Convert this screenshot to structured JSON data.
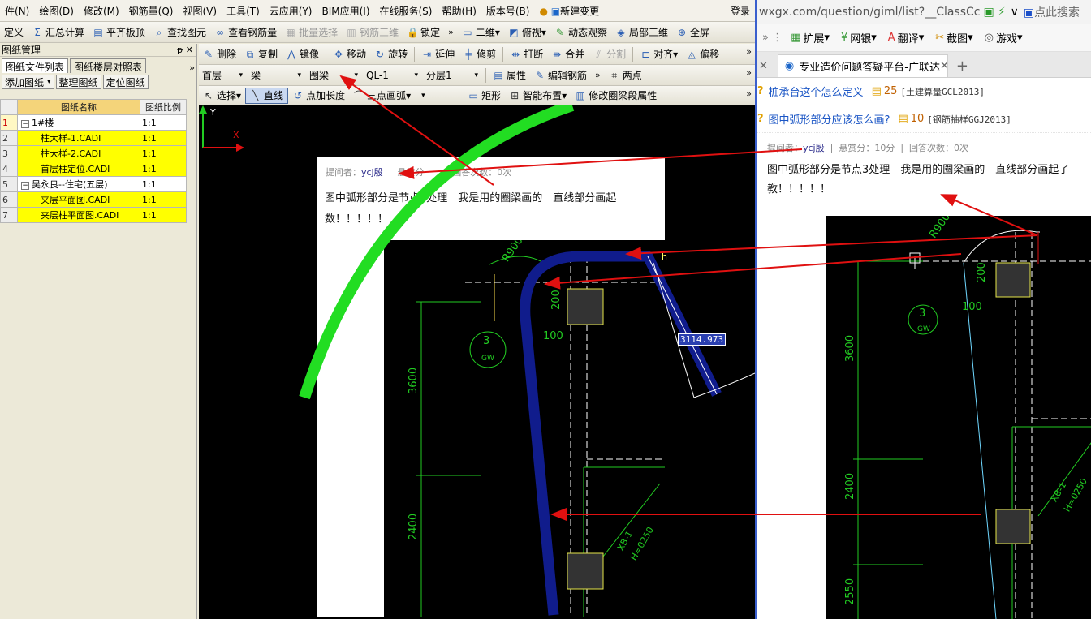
{
  "menu": {
    "items": [
      "件(N)",
      "绘图(D)",
      "修改(M)",
      "钢筋量(Q)",
      "视图(V)",
      "工具(T)",
      "云应用(Y)",
      "BIM应用(I)",
      "在线服务(S)",
      "帮助(H)",
      "版本号(B)"
    ],
    "new_change": "新建变更",
    "login": "登录"
  },
  "toolbar1": {
    "items": [
      "定义",
      "汇总计算",
      "平齐板顶",
      "查找图元",
      "查看钢筋量",
      "批量选择",
      "钢筋三维",
      "锁定"
    ],
    "view2d": "二维",
    "view_top": "俯视",
    "dynamic": "动态观察",
    "local3d": "局部三维",
    "fullscreen": "全屏"
  },
  "toolbar2": {
    "items": [
      "删除",
      "复制",
      "镜像",
      "移动",
      "旋转",
      "延伸",
      "修剪",
      "打断",
      "合并",
      "分割",
      "对齐",
      "偏移"
    ]
  },
  "toolbar3": {
    "floor": "首层",
    "category": "梁",
    "type": "圈梁",
    "element": "QL-1",
    "layer": "分层1",
    "props": "属性",
    "edit_rebar": "编辑钢筋",
    "two_points": "两点"
  },
  "toolbar4": {
    "select": "选择",
    "line": "直线",
    "point_length": "点加长度",
    "arc3": "三点画弧",
    "rect": "矩形",
    "smart": "智能布置",
    "modify_ql": "修改圈梁段属性"
  },
  "panel": {
    "title": "图纸管理",
    "tab_files": "图纸文件列表",
    "tab_floors": "图纸楼层对照表",
    "btn_add": "添加图纸",
    "btn_organize": "整理图纸",
    "btn_locate": "定位图纸",
    "col_name": "图纸名称",
    "col_scale": "图纸比例",
    "rows": [
      {
        "n": "1",
        "name": "1#楼",
        "scale": "1:1",
        "tree": "−",
        "level": 0,
        "yellow": false
      },
      {
        "n": "2",
        "name": "柱大样-1.CADI",
        "scale": "1:1",
        "tree": "",
        "level": 1,
        "yellow": true
      },
      {
        "n": "3",
        "name": "柱大样-2.CADI",
        "scale": "1:1",
        "tree": "",
        "level": 1,
        "yellow": true
      },
      {
        "n": "4",
        "name": "首层柱定位.CADI",
        "scale": "1:1",
        "tree": "",
        "level": 1,
        "yellow": true
      },
      {
        "n": "5",
        "name": "吴永良--住宅(五层)",
        "scale": "1:1",
        "tree": "−",
        "level": 0,
        "yellow": false
      },
      {
        "n": "6",
        "name": "夹层平面图.CADI",
        "scale": "1:1",
        "tree": "",
        "level": 1,
        "yellow": true
      },
      {
        "n": "7",
        "name": "夹层柱平面图.CADI",
        "scale": "1:1",
        "tree": "",
        "level": 1,
        "yellow": true
      }
    ]
  },
  "canvas": {
    "asker_label": "提问者：",
    "asker": "ycj殷",
    "reward_partial": "悬赏分",
    "answers_partial": "回答次数：0次",
    "question_line1": "图中弧形部分是节点3处理　我是用的圈梁画的　直线部分画起",
    "question_line2": "数！！！！！",
    "measure": "3114.973",
    "dim_r900": "R900",
    "dim_200": "200",
    "dim_100": "100",
    "dim_3600": "3600",
    "dim_2400": "2400",
    "label_3": "3",
    "label_gw": "GW",
    "label_xb": "XB-1",
    "label_h": "H=0250",
    "axis_y": "Y",
    "axis_x": "X"
  },
  "browser": {
    "url": "wxgx.com/question/giml/list?__ClassCc",
    "search": "点此搜索",
    "bookmarks": [
      "扩展",
      "网银",
      "翻译",
      "截图",
      "游戏"
    ],
    "tab_title": "专业造价问题答疑平台-广联达",
    "q1_link": "桩承台这个怎么定义",
    "q1_pts": "25",
    "q1_tag": "[土建算量GCL2013]",
    "q2_link": "图中弧形部分应该怎么画?",
    "q2_pts": "10",
    "q2_tag": "[钢筋抽样GGJ2013]",
    "meta_asker_label": "提问者：",
    "meta_asker": "ycj殷",
    "meta_reward": "悬赏分：10分",
    "meta_answers": "回答次数：0次",
    "body_line1": "图中弧形部分是节点3处理　我是用的圈梁画的　直线部分画起了",
    "body_line2": "教！！！！！",
    "dim_3600": "3600",
    "dim_2400": "2400",
    "dim_2550": "2550",
    "dim_r900": "R900",
    "dim_200": "200",
    "dim_100": "100",
    "label_3": "3",
    "label_gw": "GW",
    "label_xb": "XB-1",
    "label_h": "H=0250"
  },
  "colors": {
    "arc_green": "#22dd22",
    "beam_blue": "#101c8c",
    "arrow_red": "#e01010",
    "cad_green": "#22cc22",
    "row_yellow": "#ffff00",
    "browser_border": "#3a5fcd"
  }
}
